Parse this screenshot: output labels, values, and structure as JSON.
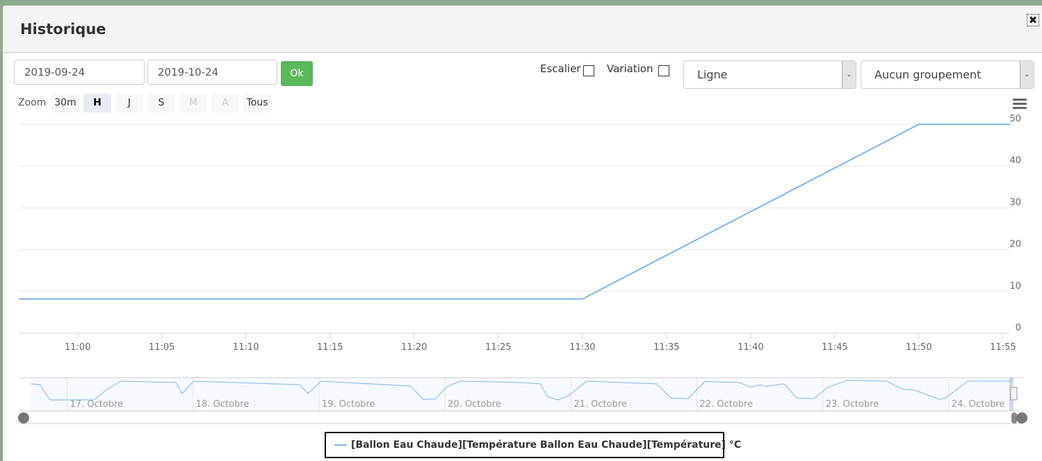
{
  "dialog": {
    "title": "Historique",
    "close_icon": "close-icon"
  },
  "controls": {
    "start_date": "2019-09-24",
    "end_date": "2019-10-24",
    "ok_label": "Ok",
    "escalier_label": "Escalier",
    "escalier_checked": false,
    "variation_label": "Variation",
    "variation_checked": false,
    "chart_type": "Ligne",
    "grouping": "Aucun groupement"
  },
  "zoom": {
    "label": "Zoom",
    "buttons": [
      {
        "label": "30m",
        "state": "normal"
      },
      {
        "label": "H",
        "state": "active"
      },
      {
        "label": "J",
        "state": "normal"
      },
      {
        "label": "S",
        "state": "normal"
      },
      {
        "label": "M",
        "state": "disabled"
      },
      {
        "label": "A",
        "state": "disabled"
      },
      {
        "label": "Tous",
        "state": "normal"
      }
    ]
  },
  "colors": {
    "series": "#7cb5ec",
    "ok_button": "#5cb85c"
  },
  "chart_data": [
    {
      "type": "line",
      "role": "main",
      "date": "2019-10-24",
      "x_range": [
        "10:56:30",
        "11:55:25"
      ],
      "x_ticks": [
        "11:00",
        "11:05",
        "11:10",
        "11:15",
        "11:20",
        "11:25",
        "11:30",
        "11:35",
        "11:40",
        "11:45",
        "11:50",
        "11:55"
      ],
      "y_range": [
        0,
        50
      ],
      "y_ticks": [
        0,
        10,
        20,
        30,
        40,
        50
      ],
      "y_axis_side": "right",
      "grid": true,
      "series": [
        {
          "name": "[Ballon Eau Chaude][Température Ballon Eau Chaude][Température] °C",
          "points": [
            [
              "10:56:30",
              8.2
            ],
            [
              "11:30",
              8.2
            ],
            [
              "11:50",
              50
            ],
            [
              "11:55:25",
              50
            ]
          ]
        }
      ]
    },
    {
      "type": "line",
      "role": "navigator",
      "x_range": [
        "2019-10-16 16:54",
        "2019-10-24 11:56"
      ],
      "x_labels": [
        "17. Octobre",
        "18. Octobre",
        "19. Octobre",
        "20. Octobre",
        "21. Octobre",
        "22. Octobre",
        "23. Octobre",
        "24. Octobre"
      ],
      "x_label_dates": [
        "2019-10-17",
        "2019-10-18",
        "2019-10-19",
        "2019-10-20",
        "2019-10-21",
        "2019-10-22",
        "2019-10-23",
        "2019-10-24"
      ],
      "points": [
        [
          "2019-10-16 17:06",
          44
        ],
        [
          "2019-10-16 18:48",
          42
        ],
        [
          "2019-10-16 20:42",
          8
        ],
        [
          "2019-10-17 05:06",
          8
        ],
        [
          "2019-10-17 07:24",
          30
        ],
        [
          "2019-10-17 10:12",
          50
        ],
        [
          "2019-10-17 20:42",
          47
        ],
        [
          "2019-10-17 21:54",
          22
        ],
        [
          "2019-10-18 00:06",
          50
        ],
        [
          "2019-10-18 20:18",
          42
        ],
        [
          "2019-10-18 21:54",
          22
        ],
        [
          "2019-10-19 00:24",
          50
        ],
        [
          "2019-10-19 17:24",
          39
        ],
        [
          "2019-10-19 19:54",
          9
        ],
        [
          "2019-10-19 22:12",
          10
        ],
        [
          "2019-10-20 00:24",
          38
        ],
        [
          "2019-10-20 02:54",
          50
        ],
        [
          "2019-10-20 14:06",
          47
        ],
        [
          "2019-10-20 18:12",
          44
        ],
        [
          "2019-10-20 19:30",
          15
        ],
        [
          "2019-10-20 21:36",
          8
        ],
        [
          "2019-10-20 23:36",
          18
        ],
        [
          "2019-10-21 03:00",
          50
        ],
        [
          "2019-10-21 16:18",
          44
        ],
        [
          "2019-10-21 19:06",
          12
        ],
        [
          "2019-10-21 22:18",
          11
        ],
        [
          "2019-10-22 01:30",
          49
        ],
        [
          "2019-10-22 08:00",
          47
        ],
        [
          "2019-10-22 10:18",
          37
        ],
        [
          "2019-10-22 12:06",
          42
        ],
        [
          "2019-10-22 13:00",
          38
        ],
        [
          "2019-10-22 16:36",
          44
        ],
        [
          "2019-10-22 19:06",
          12
        ],
        [
          "2019-10-22 22:18",
          11
        ],
        [
          "2019-10-23 00:48",
          35
        ],
        [
          "2019-10-23 04:36",
          52
        ],
        [
          "2019-10-23 12:06",
          50
        ],
        [
          "2019-10-23 15:18",
          32
        ],
        [
          "2019-10-23 17:30",
          30
        ],
        [
          "2019-10-23 22:18",
          9
        ],
        [
          "2019-10-23 23:30",
          13
        ],
        [
          "2019-10-24 03:36",
          50
        ],
        [
          "2019-10-24 11:55",
          50
        ]
      ]
    }
  ],
  "legend": {
    "label": "[Ballon Eau Chaude][Température Ballon Eau Chaude][Température] °C",
    "placement": "bottom-center"
  }
}
